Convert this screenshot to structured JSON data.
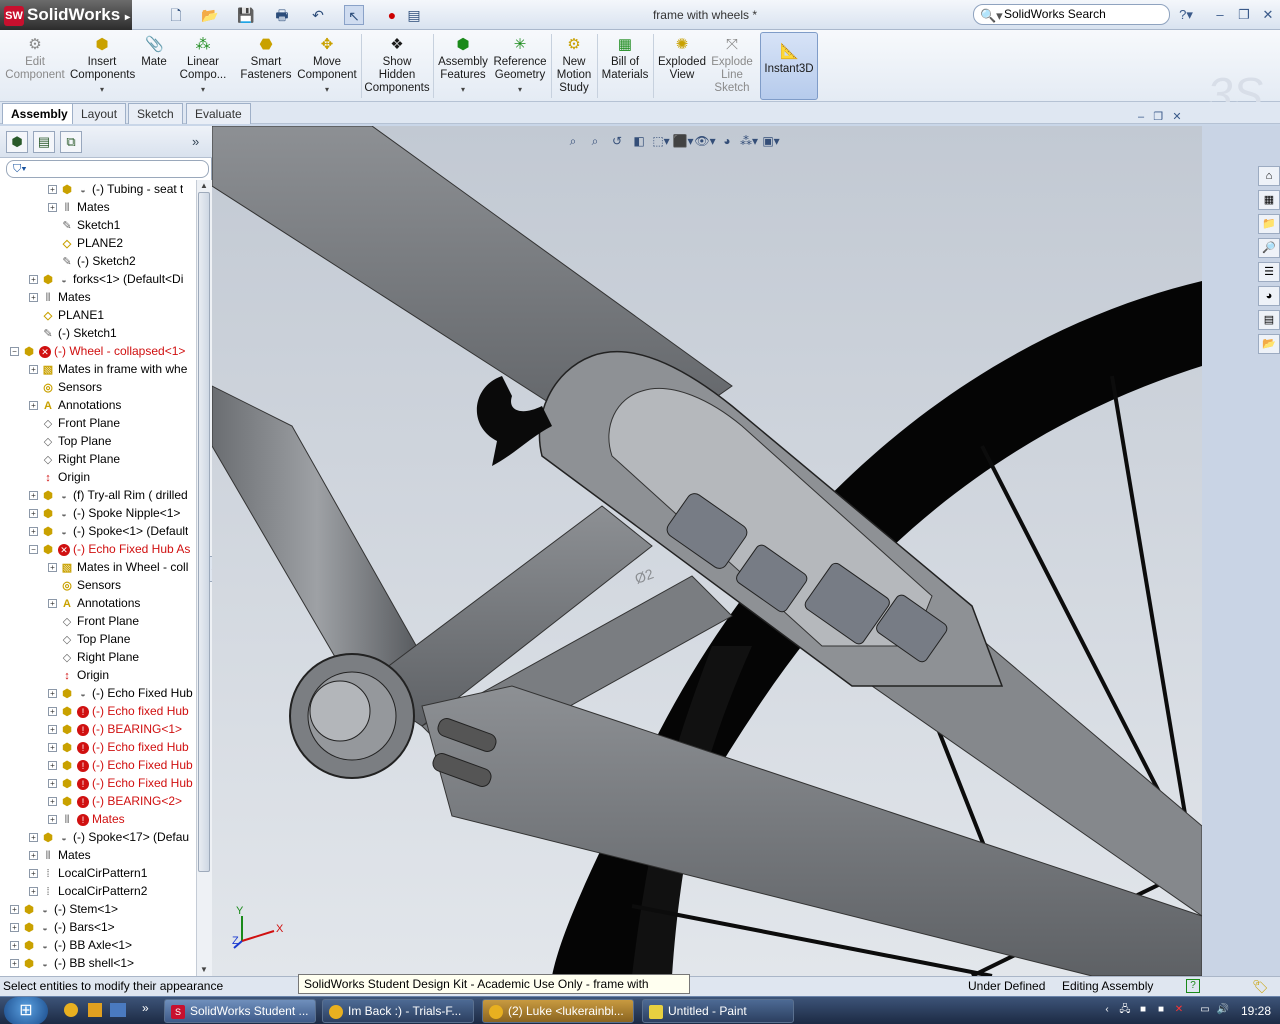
{
  "app": {
    "name": "SolidWorks",
    "doc_title": "frame with wheels *",
    "search_placeholder": "SolidWorks Search"
  },
  "ribbon": {
    "commands": [
      {
        "id": "edit-component",
        "label": "Edit Component",
        "icon": "edit-component-icon",
        "enabled": false
      },
      {
        "id": "insert-components",
        "label": "Insert Components",
        "icon": "insert-components-icon",
        "enabled": true
      },
      {
        "id": "mate",
        "label": "Mate",
        "icon": "paperclip-icon",
        "enabled": true
      },
      {
        "id": "linear-component",
        "label": "Linear Compo...",
        "icon": "linear-pattern-icon",
        "enabled": true
      },
      {
        "id": "smart-fasteners",
        "label": "Smart Fasteners",
        "icon": "smart-fasteners-icon",
        "enabled": true
      },
      {
        "id": "move-component",
        "label": "Move Component",
        "icon": "move-component-icon",
        "enabled": true
      },
      {
        "id": "show-hidden",
        "label": "Show Hidden Components",
        "icon": "show-hidden-icon",
        "enabled": true
      },
      {
        "id": "assembly-features",
        "label": "Assembly Features",
        "icon": "assembly-features-icon",
        "enabled": true
      },
      {
        "id": "reference-geometry",
        "label": "Reference Geometry",
        "icon": "reference-geometry-icon",
        "enabled": true
      },
      {
        "id": "new-motion-study",
        "label": "New Motion Study",
        "icon": "motion-study-icon",
        "enabled": true
      },
      {
        "id": "bill-of-materials",
        "label": "Bill of Materials",
        "icon": "bom-icon",
        "enabled": true
      },
      {
        "id": "exploded-view",
        "label": "Exploded View",
        "icon": "exploded-view-icon",
        "enabled": true
      },
      {
        "id": "explode-line-sketch",
        "label": "Explode Line Sketch",
        "icon": "explode-line-icon",
        "enabled": false
      },
      {
        "id": "instant3d",
        "label": "Instant3D",
        "icon": "instant3d-icon",
        "enabled": true,
        "active": true
      }
    ]
  },
  "tabs": [
    "Assembly",
    "Layout",
    "Sketch",
    "Evaluate"
  ],
  "tree": [
    {
      "label": "(-) Tubing - seat t",
      "level": 3,
      "type": "part",
      "expand": "+"
    },
    {
      "label": "Mates",
      "level": 3,
      "type": "mates",
      "expand": "+"
    },
    {
      "label": "Sketch1",
      "level": 3,
      "type": "sketch",
      "expand": ""
    },
    {
      "label": "PLANE2",
      "level": 3,
      "type": "plane",
      "expand": ""
    },
    {
      "label": "(-) Sketch2",
      "level": 3,
      "type": "sketch",
      "expand": ""
    },
    {
      "label": "forks<1> (Default<Di",
      "level": 2,
      "type": "part",
      "expand": "+"
    },
    {
      "label": "Mates",
      "level": 2,
      "type": "mates",
      "expand": "+"
    },
    {
      "label": "PLANE1",
      "level": 2,
      "type": "plane",
      "expand": ""
    },
    {
      "label": "(-) Sketch1",
      "level": 2,
      "type": "sketch",
      "expand": ""
    },
    {
      "label": "(-) Wheel - collapsed<1>",
      "level": 1,
      "type": "asm-error",
      "expand": "-",
      "red": true
    },
    {
      "label": "Mates in frame with whe",
      "level": 2,
      "type": "folder",
      "expand": "+"
    },
    {
      "label": "Sensors",
      "level": 2,
      "type": "sensor",
      "expand": ""
    },
    {
      "label": "Annotations",
      "level": 2,
      "type": "annotation",
      "expand": "+"
    },
    {
      "label": "Front Plane",
      "level": 2,
      "type": "refplane",
      "expand": ""
    },
    {
      "label": "Top Plane",
      "level": 2,
      "type": "refplane",
      "expand": ""
    },
    {
      "label": "Right Plane",
      "level": 2,
      "type": "refplane",
      "expand": ""
    },
    {
      "label": "Origin",
      "level": 2,
      "type": "origin",
      "expand": ""
    },
    {
      "label": "(f) Try-all Rim ( drilled",
      "level": 2,
      "type": "part",
      "expand": "+"
    },
    {
      "label": "(-) Spoke Nipple<1>",
      "level": 2,
      "type": "part",
      "expand": "+"
    },
    {
      "label": "(-) Spoke<1> (Default",
      "level": 2,
      "type": "part",
      "expand": "+"
    },
    {
      "label": "(-) Echo Fixed Hub As",
      "level": 2,
      "type": "asm-error",
      "expand": "-",
      "red": true
    },
    {
      "label": "Mates in Wheel - coll",
      "level": 3,
      "type": "folder",
      "expand": "+"
    },
    {
      "label": "Sensors",
      "level": 3,
      "type": "sensor",
      "expand": ""
    },
    {
      "label": "Annotations",
      "level": 3,
      "type": "annotation",
      "expand": "+"
    },
    {
      "label": "Front Plane",
      "level": 3,
      "type": "refplane",
      "expand": ""
    },
    {
      "label": "Top Plane",
      "level": 3,
      "type": "refplane",
      "expand": ""
    },
    {
      "label": "Right Plane",
      "level": 3,
      "type": "refplane",
      "expand": ""
    },
    {
      "label": "Origin",
      "level": 3,
      "type": "origin",
      "expand": ""
    },
    {
      "label": "(-) Echo Fixed Hub",
      "level": 3,
      "type": "part",
      "expand": "+"
    },
    {
      "label": "(-) Echo fixed Hub",
      "level": 3,
      "type": "part-warn",
      "expand": "+",
      "red": true
    },
    {
      "label": "(-) BEARING<1>",
      "level": 3,
      "type": "part-warn",
      "expand": "+",
      "red": true
    },
    {
      "label": "(-) Echo fixed Hub",
      "level": 3,
      "type": "part-warn",
      "expand": "+",
      "red": true
    },
    {
      "label": "(-) Echo Fixed Hub",
      "level": 3,
      "type": "part-warn",
      "expand": "+",
      "red": true
    },
    {
      "label": "(-) Echo Fixed Hub",
      "level": 3,
      "type": "part-warn",
      "expand": "+",
      "red": true
    },
    {
      "label": "(-) BEARING<2>",
      "level": 3,
      "type": "part-warn",
      "expand": "+",
      "red": true
    },
    {
      "label": "Mates",
      "level": 3,
      "type": "mates-warn",
      "expand": "+",
      "red": true
    },
    {
      "label": "(-) Spoke<17> (Defau",
      "level": 2,
      "type": "part",
      "expand": "+"
    },
    {
      "label": "Mates",
      "level": 2,
      "type": "mates",
      "expand": "+"
    },
    {
      "label": "LocalCirPattern1",
      "level": 2,
      "type": "pattern",
      "expand": "+"
    },
    {
      "label": "LocalCirPattern2",
      "level": 2,
      "type": "pattern",
      "expand": "+"
    },
    {
      "label": "(-) Stem<1>",
      "level": 1,
      "type": "part",
      "expand": "+"
    },
    {
      "label": "(-) Bars<1>",
      "level": 1,
      "type": "part",
      "expand": "+"
    },
    {
      "label": "(-) BB Axle<1>",
      "level": 1,
      "type": "part",
      "expand": "+"
    },
    {
      "label": "(-) BB shell<1>",
      "level": 1,
      "type": "part",
      "expand": "+"
    }
  ],
  "status": {
    "message": "Select entities to modify their appearance",
    "tooltip": "SolidWorks Student Design Kit - Academic Use Only - frame with wheels",
    "state1": "Under Defined",
    "state2": "Editing Assembly"
  },
  "viewport": {
    "triad": {
      "x": "X",
      "y": "Y",
      "z": "Z"
    },
    "dimension_text": "Ø2"
  },
  "taskbar": {
    "items": [
      {
        "label": "SolidWorks Student ...",
        "icon": "solidworks-icon",
        "active": true
      },
      {
        "label": "Im Back :) - Trials-F...",
        "icon": "chrome-icon",
        "active": false
      },
      {
        "label": "(2) Luke <lukerainbi...",
        "icon": "chrome-icon",
        "active": false
      },
      {
        "label": "Untitled - Paint",
        "icon": "paint-icon",
        "active": false
      }
    ],
    "clock": "19:28"
  },
  "colors": {
    "accent": "#c8102e",
    "error": "#d01010",
    "selection": "#b6cbec"
  }
}
